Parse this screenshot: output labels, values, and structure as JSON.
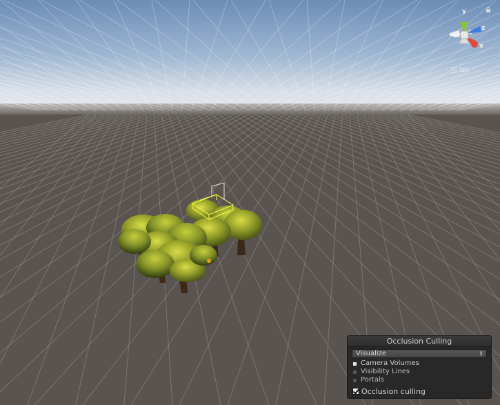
{
  "scene": {
    "gizmo": {
      "axis_y": "y",
      "axis_z": "z",
      "axis_x": "x",
      "projection_label": "Iso",
      "colors": {
        "x": "#e04a35",
        "y": "#8ac33c",
        "z": "#3c7ce0",
        "neutral": "#dcdcdc"
      }
    },
    "colors": {
      "sky_top": "#6f8fb8",
      "horizon": "#dfe3e8",
      "ground": "#5a5450",
      "selection": "#ffff40"
    }
  },
  "occlusion_panel": {
    "title": "Occlusion Culling",
    "dropdown_value": "Visualize",
    "items": [
      {
        "label": "Camera Volumes",
        "active": true
      },
      {
        "label": "Visibility Lines",
        "active": false
      },
      {
        "label": "Portals",
        "active": false
      }
    ],
    "checkbox_label": "Occlusion culling",
    "checkbox_checked": true
  }
}
